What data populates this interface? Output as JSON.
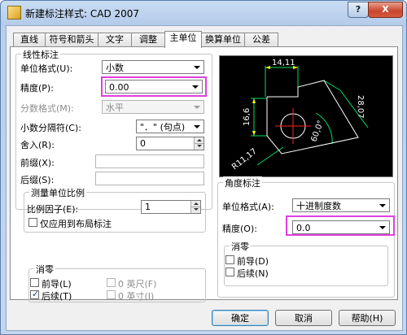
{
  "window": {
    "title": "新建标注样式: CAD 2007",
    "help_button": "?",
    "close_button": "X"
  },
  "tabs": [
    {
      "label": "直线"
    },
    {
      "label": "符号和箭头"
    },
    {
      "label": "文字"
    },
    {
      "label": "调整"
    },
    {
      "label": "主单位",
      "active": true
    },
    {
      "label": "换算单位"
    },
    {
      "label": "公差"
    }
  ],
  "linear": {
    "group_title": "线性标注",
    "unit_format_label": "单位格式(U):",
    "unit_format_value": "小数",
    "precision_label": "精度(P):",
    "precision_value": "0.00",
    "fraction_format_label": "分数格式(M):",
    "fraction_format_value": "水平",
    "decimal_sep_label": "小数分隔符(C):",
    "decimal_sep_value": "\"．\"  (句点)",
    "roundoff_label": "舍入(R):",
    "roundoff_value": "0",
    "prefix_label": "前缀(X):",
    "suffix_label": "后缀(S):"
  },
  "scale": {
    "group_title": "测量单位比例",
    "factor_label": "比例因子(E):",
    "factor_value": "1",
    "layout_only_label": "仅应用到布局标注"
  },
  "zero_linear": {
    "group_title": "消零",
    "leading_label": "前导(L)",
    "trailing_label": "后续(T)",
    "feet_label": "0 英尺(F)",
    "inches_label": "0 英寸(I)",
    "leading_checked": false,
    "trailing_checked": true
  },
  "angular": {
    "group_title": "角度标注",
    "unit_format_label": "单位格式(A):",
    "unit_format_value": "十进制度数",
    "precision_label": "精度(O):",
    "precision_value": "0.0"
  },
  "zero_angular": {
    "group_title": "消零",
    "leading_label": "前导(D)",
    "trailing_label": "后续(N)"
  },
  "preview": {
    "dim_top": "14,11",
    "dim_left": "16,6",
    "dim_right": "28,07",
    "dim_angle": "60,0°",
    "dim_radius": "R11,17"
  },
  "buttons": {
    "ok": "确定",
    "cancel": "取消",
    "help": "帮助(H)"
  },
  "colors": {
    "highlight": "#e040e0",
    "preview_green": "#00e060",
    "preview_yellow": "#ffff00",
    "preview_red": "#ff2020"
  }
}
